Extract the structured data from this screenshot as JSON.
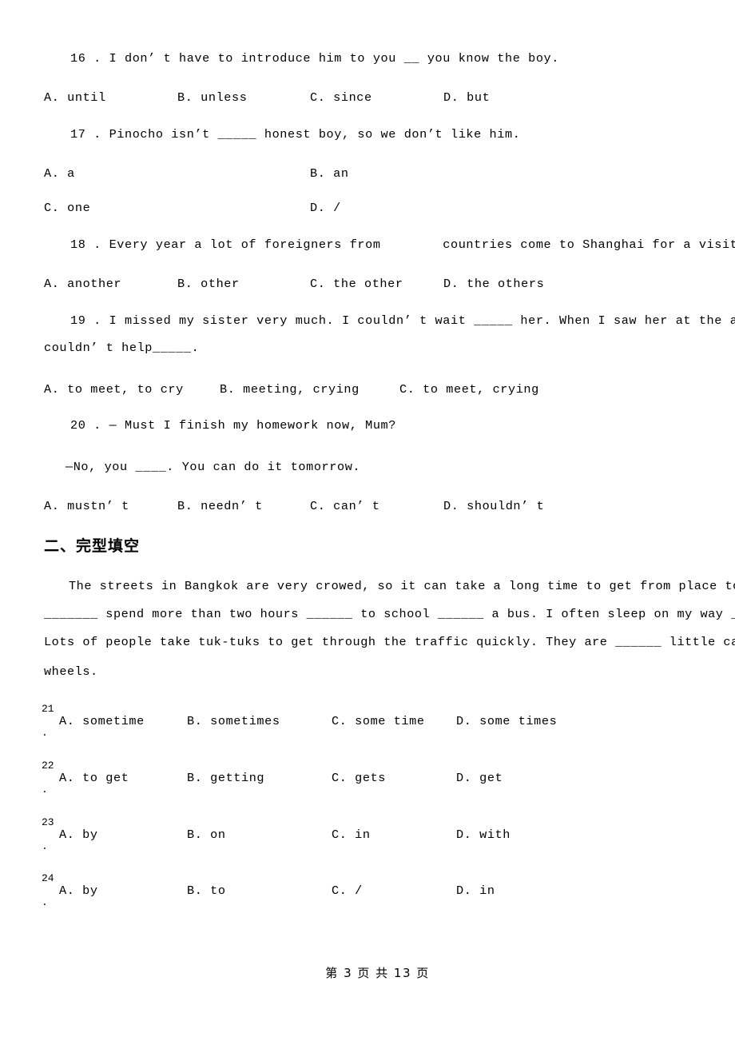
{
  "document": {
    "questions": [
      {
        "number": "16",
        "stem": "16 . I don’ t have to introduce him to you __ you know the boy.",
        "options": [
          {
            "label": "A. until"
          },
          {
            "label": "B. unless"
          },
          {
            "label": "C. since"
          },
          {
            "label": "D. but"
          }
        ]
      },
      {
        "number": "17",
        "stem": "17 . Pinocho isn’t _____ honest boy, so we don’t like him.",
        "options": [
          {
            "label": "A. a"
          },
          {
            "label": "B. an"
          },
          {
            "label": "C. one"
          },
          {
            "label": "D. /"
          }
        ]
      },
      {
        "number": "18",
        "stem": "18 . Every year a lot of foreigners from        countries come to Shanghai for a visit.",
        "options": [
          {
            "label": "A. another"
          },
          {
            "label": "B. other"
          },
          {
            "label": "C. the other"
          },
          {
            "label": "D. the others"
          }
        ]
      },
      {
        "number": "19",
        "stem_line1": "19 . I missed my sister very much. I couldn’ t wait _____ her. When I saw her at the airport, I",
        "stem_line2": "couldn’ t help_____.",
        "options": [
          {
            "label": "A. to meet, to cry"
          },
          {
            "label": "B. meeting, crying"
          },
          {
            "label": "C. to meet, crying"
          }
        ]
      },
      {
        "number": "20",
        "stem_line1": "20 . — Must I finish my homework now, Mum?",
        "stem_line2": "—No, you ____. You can do it tomorrow.",
        "options": [
          {
            "label": "A. mustn’ t"
          },
          {
            "label": "B. needn’ t"
          },
          {
            "label": "C. can’ t"
          },
          {
            "label": "D. shouldn’ t"
          }
        ]
      }
    ],
    "section_two": {
      "heading": "二、完型填空",
      "passage": [
        "The streets in Bangkok are very crowed, so it can take a long time to get from place to place. I",
        "_______ spend more than two hours ______ to school ______ a bus. I often sleep on my way ______ there!",
        "Lots of people take tuk-tuks to get through the traffic quickly. They are ______ little cars with three",
        "wheels."
      ],
      "cloze_questions": [
        {
          "number": "21",
          "dot": ".",
          "options": [
            {
              "label": "A. sometime"
            },
            {
              "label": "B. sometimes"
            },
            {
              "label": "C. some time"
            },
            {
              "label": "D. some times"
            }
          ]
        },
        {
          "number": "22",
          "dot": ".",
          "options": [
            {
              "label": "A. to get"
            },
            {
              "label": "B. getting"
            },
            {
              "label": "C. gets"
            },
            {
              "label": "D. get"
            }
          ]
        },
        {
          "number": "23",
          "dot": ".",
          "options": [
            {
              "label": "A. by"
            },
            {
              "label": "B. on"
            },
            {
              "label": "C. in"
            },
            {
              "label": "D. with"
            }
          ]
        },
        {
          "number": "24",
          "dot": ".",
          "options": [
            {
              "label": "A. by"
            },
            {
              "label": "B. to"
            },
            {
              "label": "C. /"
            },
            {
              "label": "D. in"
            }
          ]
        }
      ]
    },
    "footer": {
      "page_label": "第 3 页 共 13 页"
    }
  }
}
